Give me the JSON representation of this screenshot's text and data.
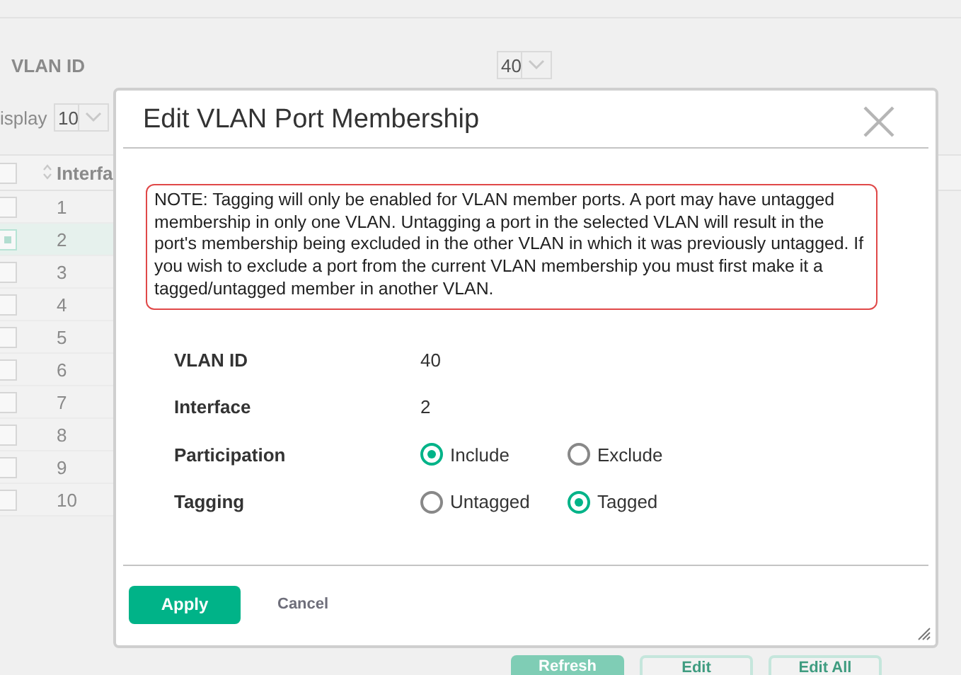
{
  "background": {
    "vlan_id": {
      "label": "VLAN ID",
      "value": "40"
    },
    "display": {
      "label": "isplay",
      "value": "10"
    },
    "table": {
      "all_checked": false,
      "columns": [
        "Interfa"
      ],
      "rows": [
        {
          "interface": "1",
          "selected": false
        },
        {
          "interface": "2",
          "selected": true
        },
        {
          "interface": "3",
          "selected": false
        },
        {
          "interface": "4",
          "selected": false
        },
        {
          "interface": "5",
          "selected": false
        },
        {
          "interface": "6",
          "selected": false
        },
        {
          "interface": "7",
          "selected": false
        },
        {
          "interface": "8",
          "selected": false
        },
        {
          "interface": "9",
          "selected": false
        },
        {
          "interface": "10",
          "selected": false
        }
      ]
    },
    "buttons": [
      {
        "label": "Refresh",
        "kind": "primary"
      },
      {
        "label": "Edit",
        "kind": "outline"
      },
      {
        "label": "Edit All",
        "kind": "outline"
      }
    ]
  },
  "dialog": {
    "title": "Edit VLAN Port Membership",
    "note": "NOTE: Tagging will only be enabled for VLAN member ports. A port may have untagged membership in only one VLAN. Untagging a port in the selected VLAN will result in the port's membership being excluded in the other VLAN in which it was previously untagged. If you wish to exclude a port from the current VLAN membership you must first make it a tagged/untagged member in another VLAN.",
    "fields": [
      {
        "kind": "text",
        "label": "VLAN ID",
        "value": "40"
      },
      {
        "kind": "text",
        "label": "Interface",
        "value": "2"
      },
      {
        "kind": "radio",
        "label": "Participation",
        "options": [
          {
            "label": "Include",
            "selected": true
          },
          {
            "label": "Exclude",
            "selected": false
          }
        ]
      },
      {
        "kind": "radio",
        "label": "Tagging",
        "options": [
          {
            "label": "Untagged",
            "selected": false
          },
          {
            "label": "Tagged",
            "selected": true
          }
        ]
      }
    ],
    "buttons": [
      {
        "label": "Apply",
        "kind": "primary"
      },
      {
        "label": "Cancel",
        "kind": "link"
      }
    ]
  }
}
